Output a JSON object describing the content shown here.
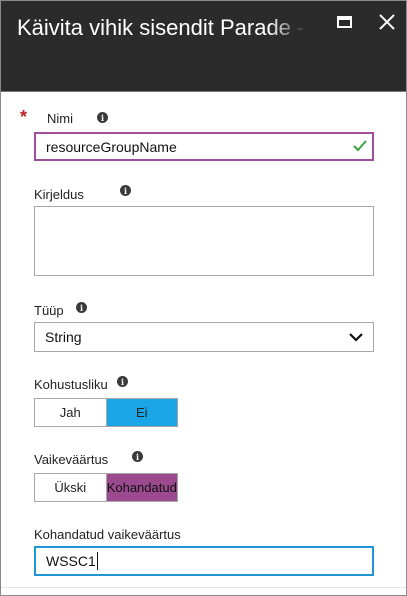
{
  "window": {
    "title": "Käivita vihik sisendit Parade -"
  },
  "form": {
    "name": {
      "required_marker": "*",
      "label": "Nimi",
      "value": "resourceGroupName"
    },
    "description": {
      "label": "Kirjeldus",
      "value": ""
    },
    "type": {
      "label": "Tüüp",
      "selected": "String"
    },
    "mandatory": {
      "label": "Kohustusliku",
      "options": [
        "Jah",
        "Ei"
      ],
      "selected": "Ei"
    },
    "default_value": {
      "label": "Vaikeväärtus",
      "options": [
        "Ükski",
        "Kohandatud"
      ],
      "selected": "Kohandatud"
    },
    "custom_default": {
      "label": "Kohandatud vaikeväärtus",
      "value": "WSSC1"
    }
  },
  "icons": {
    "info": "info-icon",
    "check": "check-icon",
    "chevron": "chevron-down-icon",
    "maximize": "maximize-icon",
    "close": "close-icon"
  },
  "colors": {
    "titlebar": "#2b2b2b",
    "accent_purple": "#9b4a8f",
    "accent_blue": "#1aa6e6",
    "valid_check": "#3ea33e",
    "required": "#c41e1e"
  }
}
